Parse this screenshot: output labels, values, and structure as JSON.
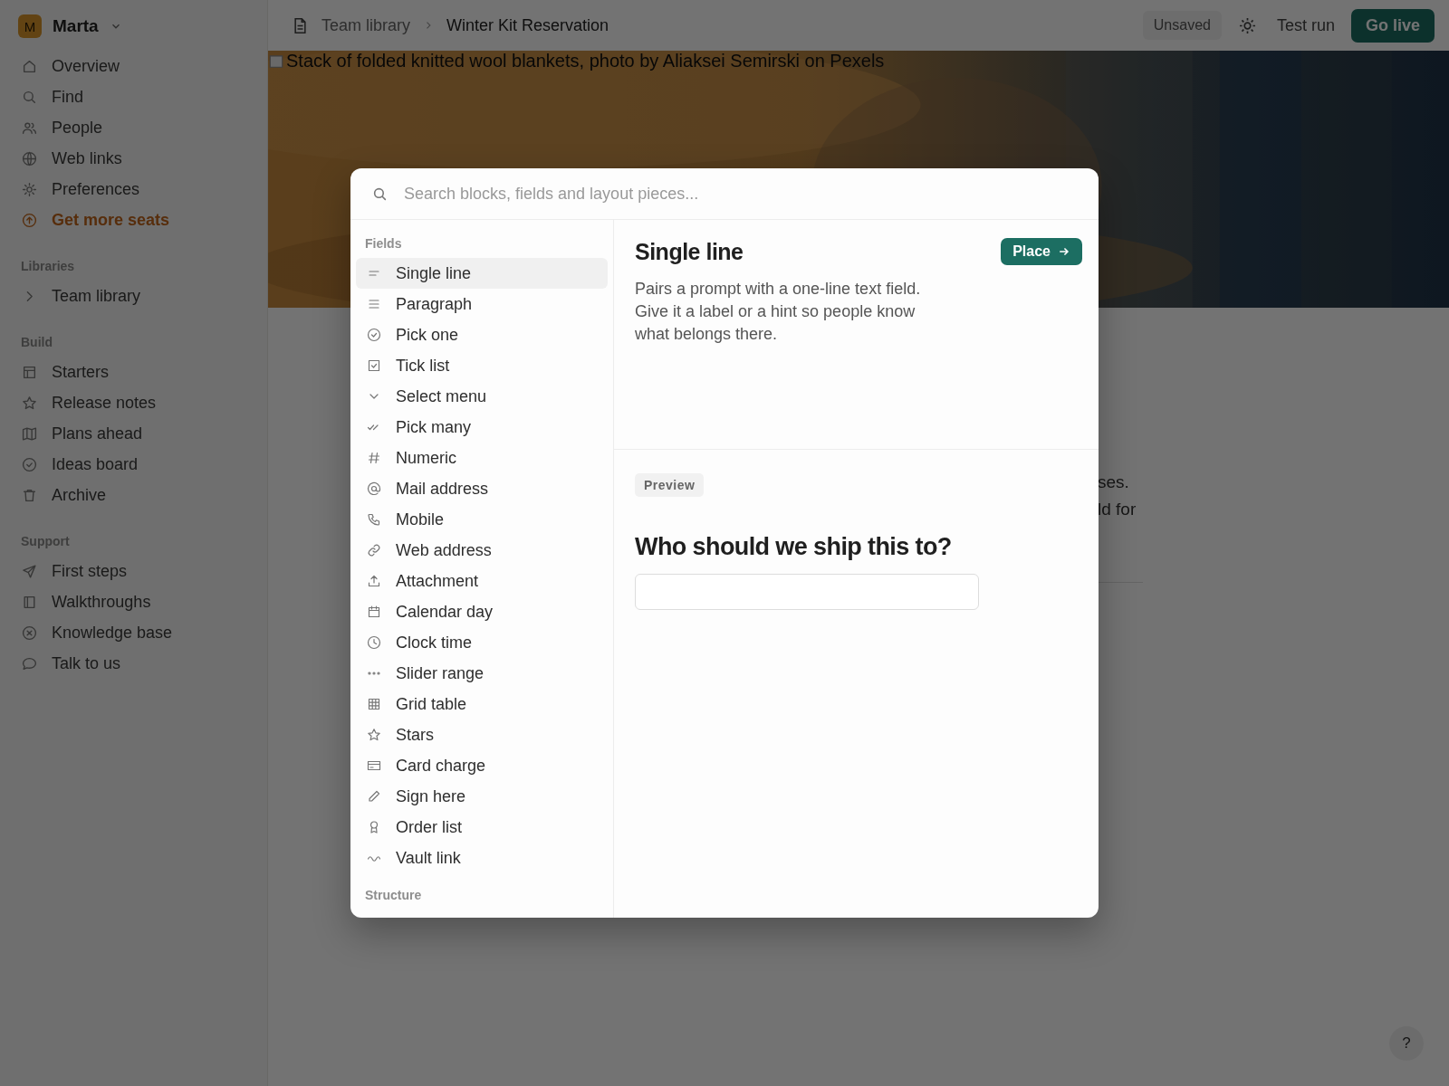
{
  "sidebar": {
    "workspace": {
      "initial": "M",
      "name": "Marta"
    },
    "nav": [
      {
        "label": "Overview",
        "kind": "normal"
      },
      {
        "label": "Find",
        "kind": "normal"
      },
      {
        "label": "People",
        "kind": "normal"
      },
      {
        "label": "Web links",
        "kind": "normal"
      },
      {
        "label": "Preferences",
        "kind": "normal"
      },
      {
        "label": "Get more seats",
        "kind": "upsell"
      }
    ],
    "libraries": {
      "title": "Libraries",
      "items": [
        {
          "label": "Team library",
          "expanded": false
        }
      ]
    },
    "build": {
      "title": "Build",
      "items": [
        "Starters",
        "Release notes",
        "Plans ahead",
        "Ideas board",
        "Archive"
      ]
    },
    "support": {
      "title": "Support",
      "items": [
        "First steps",
        "Walkthroughs",
        "Knowledge base",
        "Talk to us"
      ]
    }
  },
  "topbar": {
    "breadcrumb": [
      "Team library",
      "Winter Kit Reservation"
    ],
    "status": "Unsaved",
    "test_run": "Test run",
    "go_live": "Go live"
  },
  "hero": {
    "image_alt": "Stack of folded knitted wool blankets, photo by Aliaksei Semirski on Pexels"
  },
  "background_text": [
    "ses.",
    "ld for"
  ],
  "modal": {
    "search": {
      "placeholder": "Search blocks, fields and layout pieces..."
    },
    "groups": [
      {
        "title": "Fields",
        "items": [
          {
            "label": "Single line",
            "selected": true
          },
          {
            "label": "Paragraph",
            "selected": false
          },
          {
            "label": "Pick one",
            "selected": false
          },
          {
            "label": "Tick list",
            "selected": false
          },
          {
            "label": "Select menu",
            "selected": false
          },
          {
            "label": "Pick many",
            "selected": false
          },
          {
            "label": "Numeric",
            "selected": false
          },
          {
            "label": "Mail address",
            "selected": false
          },
          {
            "label": "Mobile",
            "selected": false
          },
          {
            "label": "Web address",
            "selected": false
          },
          {
            "label": "Attachment",
            "selected": false
          },
          {
            "label": "Calendar day",
            "selected": false
          },
          {
            "label": "Clock time",
            "selected": false
          },
          {
            "label": "Slider range",
            "selected": false
          },
          {
            "label": "Grid table",
            "selected": false
          },
          {
            "label": "Stars",
            "selected": false
          },
          {
            "label": "Card charge",
            "selected": false
          },
          {
            "label": "Sign here",
            "selected": false
          },
          {
            "label": "Order list",
            "selected": false
          },
          {
            "label": "Vault link",
            "selected": false
          }
        ]
      },
      {
        "title": "Structure"
      }
    ],
    "detail": {
      "title": "Single line",
      "place_button": "Place",
      "description": "Pairs a prompt with a one-line text field. Give it a label or a hint so people know what belongs there.",
      "preview_tag": "Preview",
      "preview_question": "Who should we ship this to?"
    }
  },
  "help": "?"
}
